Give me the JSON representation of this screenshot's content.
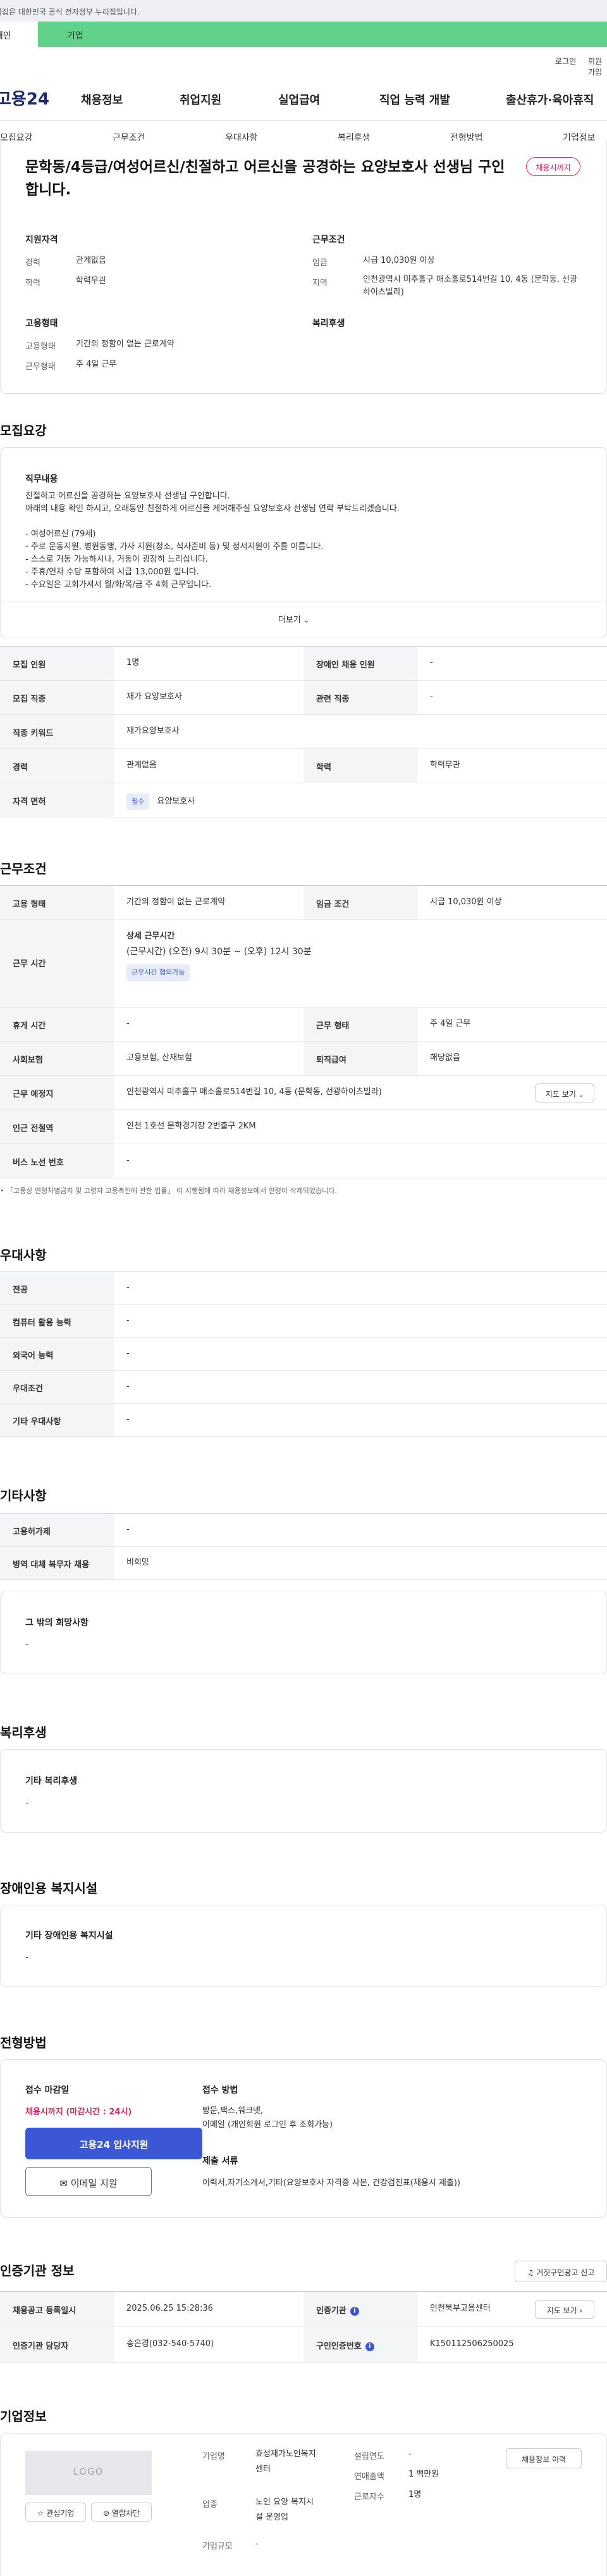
{
  "gov_banner": "이 누리집은 대한민국 공식 전자정부 누리집입니다.",
  "top_tabs": {
    "personal": "개인",
    "company": "기업"
  },
  "util": {
    "login": "로그인",
    "join": "회원가입"
  },
  "logo": "고용24",
  "gnb": [
    "채용정보",
    "취업지원",
    "실업급여",
    "직업 능력 개발",
    "출산휴가·육아휴직"
  ],
  "subnav": [
    "모집요강",
    "근무조건",
    "우대사항",
    "복리후생",
    "전형방법",
    "기업정보"
  ],
  "summary": {
    "title": "문학동/4등급/여성어르신/친절하고 어르신을 공경하는 요양보호사 선생님 구인합니다.",
    "badge": "채용시까지",
    "qual_title": "지원자격",
    "qual": [
      {
        "label": "경력",
        "value": "관계없음"
      },
      {
        "label": "학력",
        "value": "학력무관"
      }
    ],
    "cond_title": "근무조건",
    "cond": [
      {
        "label": "임금",
        "value": "시급 10,030원 이상"
      },
      {
        "label": "지역",
        "value": "인천광역시 미추홀구 매소홀로514번길 10, 4동 (문학동, 선광하이츠빌라)"
      }
    ],
    "emp_title": "고용형태",
    "emp": [
      {
        "label": "고용형태",
        "value": "기간의 정함이 없는 근로계약"
      },
      {
        "label": "근무형태",
        "value": "주 4일 근무"
      }
    ],
    "welfare_title": "복리후생"
  },
  "recruit": {
    "heading": "모집요강",
    "duty_title": "직무내용",
    "duty_lines": [
      "친절하고 어르신을 공경하는 요양보호사 선생님 구인합니다.",
      "아래의 내용 확인 하시고, 오래동안 친절하게 어르신을 케어해주실 요양보호사 선생님 연락 부탁드리겠습니다.",
      "",
      "- 여성어르신 (79세)",
      "- 주로 운동지원, 병원동행, 가사 지원(청소, 식사준비 등) 및 정서지원이 주를 이룹니다.",
      "- 스스로 거동 가능하시나, 거동이 굉장히 느리십니다.",
      "- 주휴/연차 수당 포함하여 시급 13,000원 입니다.",
      "- 수요일은 교회가셔서 월/화/목/금 주 4회 근무입니다."
    ],
    "more": "더보기",
    "rows": [
      {
        "h1": "모집 인원",
        "v1": "1명",
        "h2": "장애인 채용 인원",
        "v2": "-"
      },
      {
        "h1": "모집 직종",
        "v1": "재가 요양보호사",
        "h2": "관련 직종",
        "v2": "-"
      },
      {
        "h1": "직종 키워드",
        "v1": "재가요양보호사"
      },
      {
        "h1": "경력",
        "v1": "관계없음",
        "h2": "학력",
        "v2": "학력무관"
      }
    ],
    "license_h": "자격 면허",
    "license_badge": "필수",
    "license_v": "요양보호사"
  },
  "work": {
    "heading": "근무조건",
    "emp_h": "고용 형태",
    "emp_v": "기간의 정함이 없는 근로계약",
    "wage_h": "임금 조건",
    "wage_v": "시급 10,030원 이상",
    "hours_h": "근무 시간",
    "hours_title": "상세 근무시간",
    "hours_v": "(근무시간) (오전) 9시 30분 ~ (오후) 12시 30분",
    "hours_badge": "근무시간 협의가능",
    "break_h": "휴게 시간",
    "break_v": "-",
    "type_h": "근무 형태",
    "type_v": "주 4일 근무",
    "ins_h": "사회보험",
    "ins_v": "고용보험, 산재보험",
    "sev_h": "퇴직급여",
    "sev_v": "해당없음",
    "place_h": "근무 예정지",
    "place_v": "인천광역시 미추홀구 매소홀로514번길 10, 4동 (문학동, 선광하이츠빌라)",
    "map_btn": "지도 보기",
    "station_h": "인근 전철역",
    "station_v": "인천 1호선 문학경기장 2번출구 2KM",
    "bus_h": "버스 노선 번호",
    "bus_v": "-",
    "note": "「고용상 연령차별금지 및 고령자 고용촉진에 관한 법률」 이 시행됨에 따라 채용정보에서 연령이 삭제되었습니다."
  },
  "pref": {
    "heading": "우대사항",
    "rows": [
      {
        "h": "전공",
        "v": "-"
      },
      {
        "h": "컴퓨터 활용 능력",
        "v": "-"
      },
      {
        "h": "외국어 능력",
        "v": "-"
      },
      {
        "h": "우대조건",
        "v": "-"
      },
      {
        "h": "기타 우대사항",
        "v": "-"
      }
    ]
  },
  "etc": {
    "heading": "기타사항",
    "rows": [
      {
        "h": "고용허가제",
        "v": "-"
      },
      {
        "h": "병역 대체 복무자 채용",
        "v": "비희망"
      }
    ],
    "other_title": "그 밖의 희망사항",
    "other_v": "-"
  },
  "welfare": {
    "heading": "복리후생",
    "title": "기타 복리후생",
    "v": "-"
  },
  "disability": {
    "heading": "장애인용 복지시설",
    "title": "기타 장애인용 복지시설",
    "v": "-"
  },
  "selection": {
    "heading": "전형방법",
    "deadline_title": "접수 마감일",
    "deadline_v": "채용시까지 (마감시간 : 24시)",
    "apply_btn": "고용24 입사지원",
    "email_btn": "이메일 지원",
    "method_title": "접수 방법",
    "method_v1": "방문,팩스,워크넷,",
    "method_v2": "이메일 (개인회원 로그인 후 조회가능)",
    "docs_title": "제출 서류",
    "docs_v": "이력서,자기소개서,기타(요양보호사 자격증 사본, 건강검진표(채용시 제출))"
  },
  "agency": {
    "heading": "인증기관 정보",
    "report_btn": "거짓구인광고 신고",
    "rows": [
      {
        "h1": "채용공고 등록일시",
        "v1": "2025.06.25 15:28:36",
        "h2": "인증기관",
        "v2": "인천북부고용센터",
        "btn": "지도 보기"
      },
      {
        "h1": "인증기관 담당자",
        "v1": "송은경(032-540-5740)",
        "h2": "구인인증번호",
        "v2": "K150112506250025"
      }
    ]
  },
  "company": {
    "heading": "기업정보",
    "logo": "LOGO",
    "fav_btn": "관심기업",
    "block_btn": "열람차단",
    "history_btn": "채용정보 이력",
    "name_h": "기업명",
    "name_v1": "효성재가노인복지",
    "name_v2": "센터",
    "ind_h": "업종",
    "ind_v1": "노인 요양 복지시",
    "ind_v2": "설 운영업",
    "size_h": "기업규모",
    "size_v": "-",
    "est_h": "설립연도",
    "est_v": "-",
    "sales_h": "연매출액",
    "sales_v": "1 백만원",
    "emp_h": "근로자수",
    "emp_v": "1명"
  }
}
